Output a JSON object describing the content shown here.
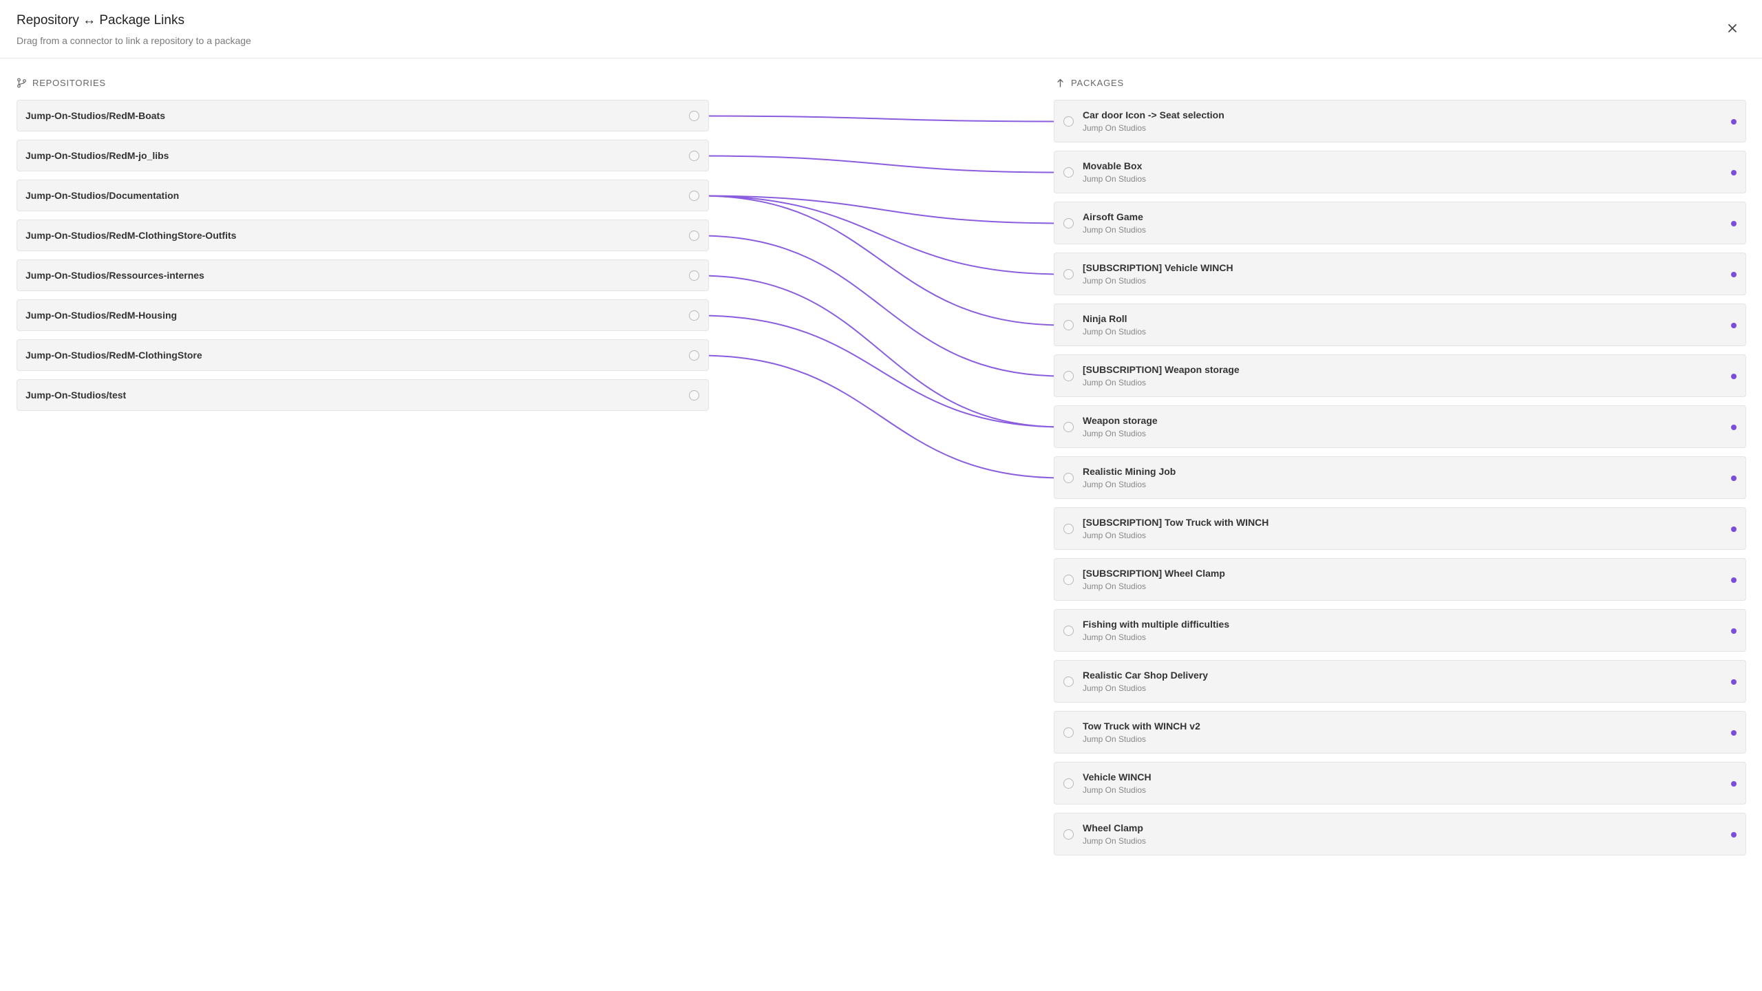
{
  "header": {
    "title": "Repository ↔ Package Links",
    "subtitle": "Drag from a connector to link a repository to a package"
  },
  "repositories": {
    "heading": "REPOSITORIES",
    "items": [
      {
        "label": "Jump-On-Studios/RedM-Boats"
      },
      {
        "label": "Jump-On-Studios/RedM-jo_libs"
      },
      {
        "label": "Jump-On-Studios/Documentation"
      },
      {
        "label": "Jump-On-Studios/RedM-ClothingStore-Outfits"
      },
      {
        "label": "Jump-On-Studios/Ressources-internes"
      },
      {
        "label": "Jump-On-Studios/RedM-Housing"
      },
      {
        "label": "Jump-On-Studios/RedM-ClothingStore"
      },
      {
        "label": "Jump-On-Studios/test"
      }
    ]
  },
  "packages": {
    "heading": "PACKAGES",
    "items": [
      {
        "title": "Car door Icon -> Seat selection",
        "vendor": "Jump On Studios"
      },
      {
        "title": "Movable Box",
        "vendor": "Jump On Studios"
      },
      {
        "title": "Airsoft Game",
        "vendor": "Jump On Studios"
      },
      {
        "title": "[SUBSCRIPTION] Vehicle WINCH",
        "vendor": "Jump On Studios"
      },
      {
        "title": "Ninja Roll",
        "vendor": "Jump On Studios"
      },
      {
        "title": "[SUBSCRIPTION] Weapon storage",
        "vendor": "Jump On Studios"
      },
      {
        "title": "Weapon storage",
        "vendor": "Jump On Studios"
      },
      {
        "title": "Realistic Mining Job",
        "vendor": "Jump On Studios"
      },
      {
        "title": "[SUBSCRIPTION] Tow Truck with WINCH",
        "vendor": "Jump On Studios"
      },
      {
        "title": "[SUBSCRIPTION] Wheel Clamp",
        "vendor": "Jump On Studios"
      },
      {
        "title": "Fishing with multiple difficulties",
        "vendor": "Jump On Studios"
      },
      {
        "title": "Realistic Car Shop Delivery",
        "vendor": "Jump On Studios"
      },
      {
        "title": "Tow Truck with WINCH v2",
        "vendor": "Jump On Studios"
      },
      {
        "title": "Vehicle WINCH",
        "vendor": "Jump On Studios"
      },
      {
        "title": "Wheel Clamp",
        "vendor": "Jump On Studios"
      }
    ]
  },
  "links": [
    {
      "repo": 0,
      "pkg": 0
    },
    {
      "repo": 1,
      "pkg": 1
    },
    {
      "repo": 2,
      "pkg": 2
    },
    {
      "repo": 2,
      "pkg": 3
    },
    {
      "repo": 2,
      "pkg": 4
    },
    {
      "repo": 3,
      "pkg": 5
    },
    {
      "repo": 4,
      "pkg": 6
    },
    {
      "repo": 5,
      "pkg": 6
    },
    {
      "repo": 6,
      "pkg": 7
    }
  ],
  "colors": {
    "accent": "#7c4ddb",
    "link_line": "#8a5cdf"
  },
  "icons": {
    "close": "close-icon",
    "repositories": "git-branch-icon",
    "packages": "package-arrow-icon"
  }
}
